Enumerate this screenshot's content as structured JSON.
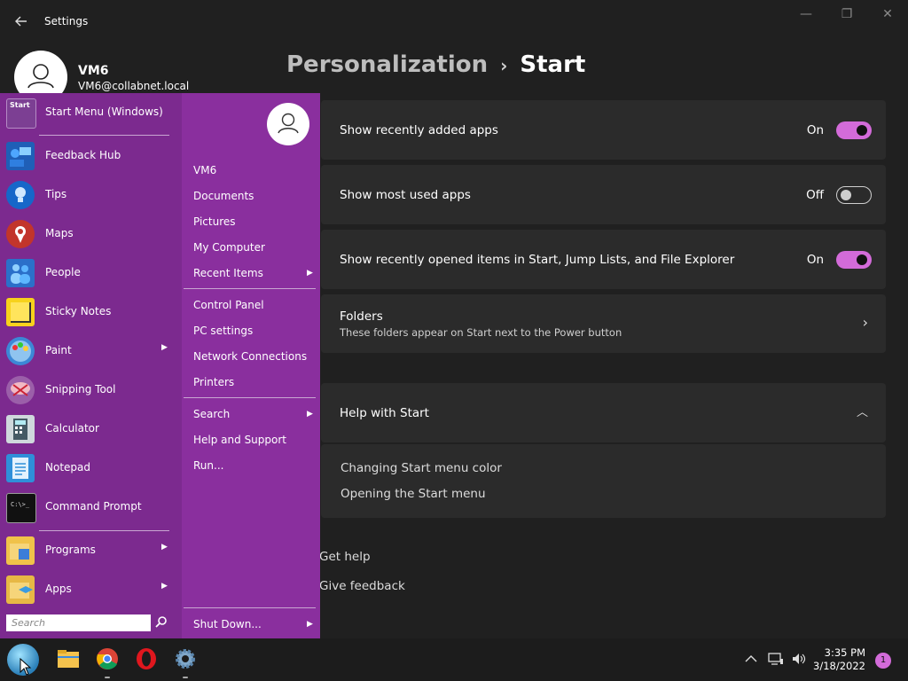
{
  "window": {
    "title": "Settings",
    "minimize_icon": "minimize-icon",
    "maximize_icon": "maximize-icon",
    "close_icon": "close-icon"
  },
  "user": {
    "name": "VM6",
    "email": "VM6@collabnet.local"
  },
  "breadcrumb": {
    "parent": "Personalization",
    "separator": "›",
    "current": "Start"
  },
  "settings": [
    {
      "label": "Show recently added apps",
      "state": "On"
    },
    {
      "label": "Show most used apps",
      "state": "Off"
    },
    {
      "label": "Show recently opened items in Start, Jump Lists, and File Explorer",
      "state": "On"
    }
  ],
  "folders": {
    "label": "Folders",
    "description": "These folders appear on Start next to the Power button"
  },
  "help": {
    "title": "Help with Start",
    "links": [
      "Changing Start menu color",
      "Opening the Start menu"
    ]
  },
  "footer": {
    "get_help": "Get help",
    "give_feedback": "Give feedback"
  },
  "start_menu": {
    "pinned": {
      "label": "Start Menu (Windows)",
      "icon_text": "Start"
    },
    "apps": [
      {
        "label": "Feedback Hub"
      },
      {
        "label": "Tips"
      },
      {
        "label": "Maps"
      },
      {
        "label": "People"
      },
      {
        "label": "Sticky Notes"
      },
      {
        "label": "Paint",
        "arrow": "▶"
      },
      {
        "label": "Snipping Tool"
      },
      {
        "label": "Calculator"
      },
      {
        "label": "Notepad"
      },
      {
        "label": "Command Prompt"
      }
    ],
    "programs": {
      "label": "Programs",
      "arrow": "▶"
    },
    "apps_folder": {
      "label": "Apps",
      "arrow": "▶"
    },
    "search_placeholder": "Search",
    "right": {
      "user": "VM6",
      "documents": "Documents",
      "pictures": "Pictures",
      "my_computer": "My Computer",
      "recent_items": "Recent Items",
      "control_panel": "Control Panel",
      "pc_settings": "PC settings",
      "network_connections": "Network Connections",
      "printers": "Printers",
      "search": "Search",
      "help_support": "Help and Support",
      "run": "Run...",
      "shut_down": "Shut Down...",
      "arrow": "▶"
    }
  },
  "taskbar": {
    "time": "3:35 PM",
    "date": "3/18/2022",
    "notifications": "1"
  },
  "colors": {
    "accent": "#d36bd9",
    "start_menu": "#8a2f9e",
    "background": "#202020",
    "card": "#2b2b2b"
  }
}
